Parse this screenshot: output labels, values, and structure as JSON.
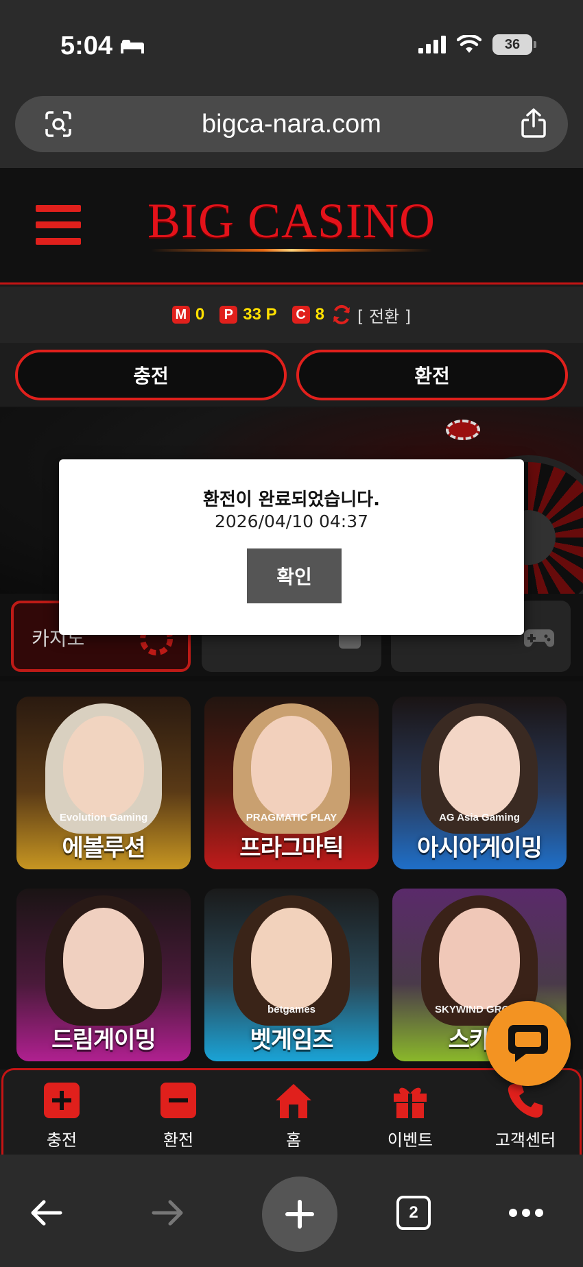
{
  "status_bar": {
    "time": "5:04",
    "battery": "36"
  },
  "browser": {
    "url": "bigca-nara.com",
    "tab_count": "2"
  },
  "header": {
    "logo": "BIG CASINO"
  },
  "points": {
    "money": {
      "badge": "M",
      "value": "0"
    },
    "point": {
      "badge": "P",
      "value": "33 P"
    },
    "coupon": {
      "badge": "C",
      "value": "8"
    },
    "switch_label": "[ 전환 ]"
  },
  "actions": {
    "deposit": "충전",
    "withdraw": "환전"
  },
  "tabs": [
    {
      "label": "카지노",
      "icon": "casino-chip-icon",
      "active": true
    },
    {
      "label": "",
      "icon": "slot-icon",
      "active": false
    },
    {
      "label": "",
      "icon": "gamepad-icon",
      "active": false
    }
  ],
  "games": [
    {
      "name": "에볼루션",
      "brand": "Evolution Gaming",
      "color": "#c79622"
    },
    {
      "name": "프라그마틱",
      "brand": "PRAGMATIC PLAY",
      "color": "#c01b1b"
    },
    {
      "name": "아시아게이밍",
      "brand": "AG Asia Gaming",
      "color": "#1f6fc8"
    },
    {
      "name": "드림게이밍",
      "brand": "",
      "color": "#b02090"
    },
    {
      "name": "벳게임즈",
      "brand": "betgames",
      "color": "#1aa3d6"
    },
    {
      "name": "스카이",
      "brand": "SKYWIND GROUP",
      "color": "#8ab82a"
    }
  ],
  "modal": {
    "title": "환전이 완료되었습니다.",
    "date": "2026/04/10 04:37",
    "confirm": "확인"
  },
  "bottom_nav": [
    {
      "label": "충전",
      "icon": "plus-icon"
    },
    {
      "label": "환전",
      "icon": "minus-icon"
    },
    {
      "label": "홈",
      "icon": "home-icon"
    },
    {
      "label": "이벤트",
      "icon": "gift-icon"
    },
    {
      "label": "고객센터",
      "icon": "phone-icon"
    }
  ],
  "colors": {
    "accent": "#e0201c",
    "points_yellow": "#ffe000",
    "chat": "#f39322"
  }
}
